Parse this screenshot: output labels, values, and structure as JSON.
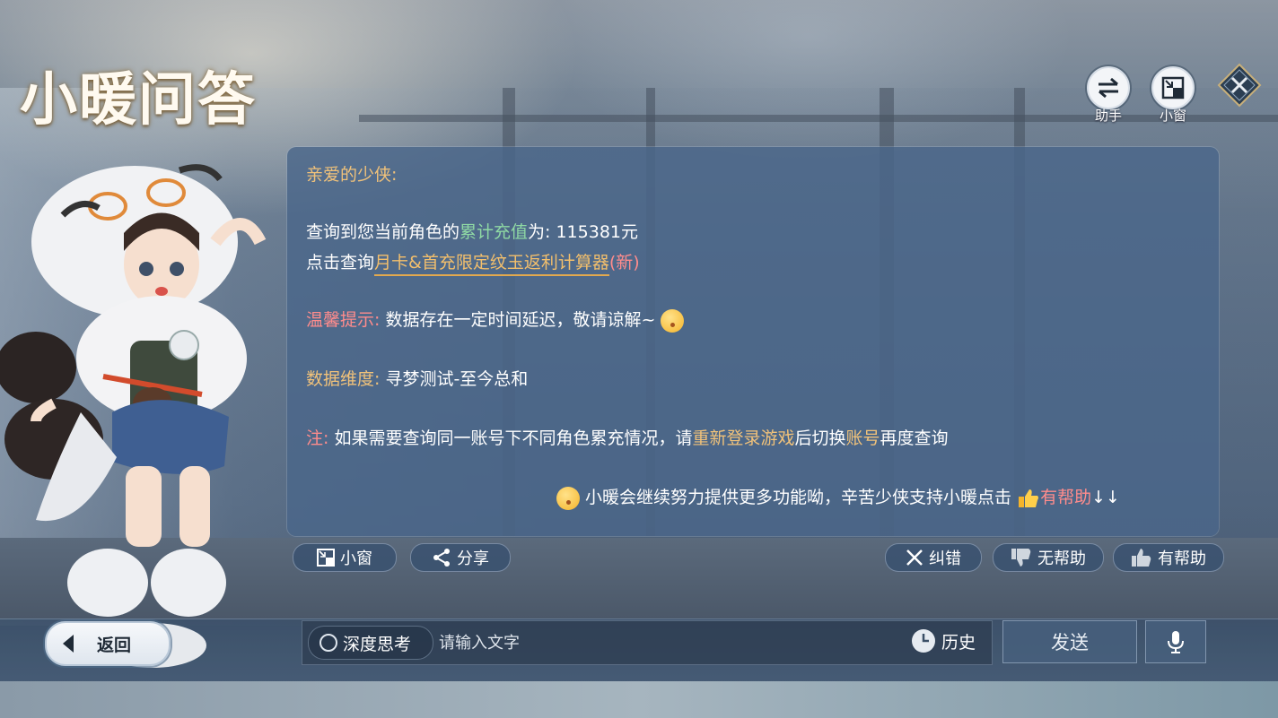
{
  "title": "小暖问答",
  "top_buttons": {
    "assistant_label": "助手",
    "small_window_label": "小窗"
  },
  "message": {
    "greeting": "亲爱的少侠:",
    "query_prefix": "查询到您当前角色的",
    "query_highlight": "累计充值",
    "query_suffix": "为: 115381元",
    "click_prefix": "点击查询",
    "click_link": "月卡&首充限定纹玉返利计算器",
    "click_new": "(新)",
    "tip_label": "温馨提示:",
    "tip_text": " 数据存在一定时间延迟，敬请谅解~",
    "dimension_label": "数据维度:",
    "dimension_text": " 寻梦测试-至今总和",
    "note_label": "注:",
    "note_text1": " 如果需要查询同一账号下不同角色累充情况，请",
    "note_highlight1": "重新登录游戏",
    "note_text2": "后切换",
    "note_highlight2": "账号",
    "note_text3": "再度查询",
    "footer_text": "小暖会继续努力提供更多功能呦，辛苦少侠支持小暖点击",
    "footer_helpful": "有帮助",
    "footer_arrows": "↓↓"
  },
  "actions": {
    "small_window": "小窗",
    "share": "分享",
    "correct": "纠错",
    "not_helpful": "无帮助",
    "helpful": "有帮助"
  },
  "bottom": {
    "back": "返回",
    "deep_think": "深度思考",
    "input_placeholder": "请输入文字",
    "history": "历史",
    "send": "发送"
  },
  "icons": [
    "swap-icon",
    "small-window-icon",
    "close-icon",
    "share-icon",
    "x-icon",
    "thumbs-down-icon",
    "thumbs-up-icon",
    "clock-icon",
    "microphone-icon",
    "emoji-icon"
  ],
  "colors": {
    "orange": "#f1c27a",
    "green": "#8fd9a4",
    "red": "#ff8c8c"
  }
}
